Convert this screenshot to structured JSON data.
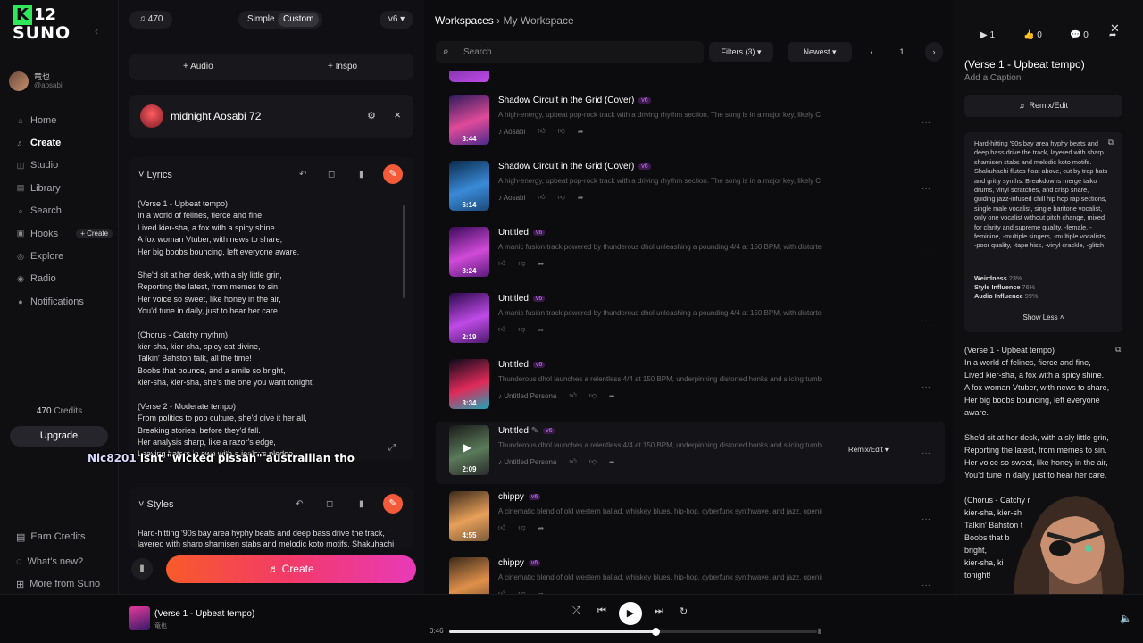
{
  "app": {
    "logo_k": "K",
    "logo_num": "12",
    "logo_word": "SUNO",
    "collapse": "‹"
  },
  "user": {
    "name": "竜也",
    "handle": "@aosabi"
  },
  "nav": {
    "items": [
      {
        "label": "Home",
        "icon": "⌂"
      },
      {
        "label": "Create",
        "icon": "♬"
      },
      {
        "label": "Studio",
        "icon": "◫"
      },
      {
        "label": "Library",
        "icon": "▤"
      },
      {
        "label": "Search",
        "icon": "⌕"
      },
      {
        "label": "Hooks",
        "icon": "▣"
      },
      {
        "label": "Explore",
        "icon": "◎"
      },
      {
        "label": "Radio",
        "icon": "◉"
      },
      {
        "label": "Notifications",
        "icon": "●"
      }
    ],
    "hooks_create": "+ Create",
    "credits_value": "470",
    "credits_label": "Credits",
    "upgrade": "Upgrade",
    "bottom": [
      {
        "label": "Earn Credits",
        "icon": "▤"
      },
      {
        "label": "What's new?",
        "icon": "◌"
      },
      {
        "label": "More from Suno",
        "icon": "⊞"
      }
    ],
    "socials": [
      "♪",
      "◈"
    ]
  },
  "create_panel": {
    "credits_pill": "♫ 470",
    "mode_simple": "Simple",
    "mode_custom": "Custom",
    "version": "v6 ▾",
    "add_audio": "+ Audio",
    "add_inspo": "+ Inspo",
    "song_title": "midnight Aosabi 72",
    "lyrics_label": "Lyrics",
    "lyrics": [
      [
        "(Verse 1 - Upbeat tempo)",
        "In a world of felines, fierce and fine,",
        "Lived kier-sha, a fox with a spicy shine.",
        "A fox woman Vtuber, with news to share,",
        "Her big boobs bouncing, left everyone aware."
      ],
      [
        "She'd sit at her desk, with a sly little grin,",
        "Reporting the latest, from memes to sin.",
        "Her voice so sweet, like honey in the air,",
        "You'd tune in daily, just to hear her care."
      ],
      [
        "(Chorus - Catchy rhythm)",
        "kier-sha, kier-sha, spicy cat divine,",
        "Talkin' Bahston talk, all the time!",
        "Boobs that bounce, and a smile so bright,",
        "kier-sha, kier-sha, she's the one you want tonight!"
      ],
      [
        "(Verse 2 - Moderate tempo)",
        "From politics to pop culture, she'd give it her all,",
        "Breaking stories, before they'd fall.",
        "Her analysis sharp, like a razor's edge,",
        "Leaving haters in awe with a jealous pledge."
      ]
    ],
    "styles_label": "Styles",
    "styles_text": "Hard-hitting '90s bay area hyphy beats and deep bass drive the track, layered with sharp shamisen stabs and melodic koto motifs. Shakuhachi",
    "create_button": "♬ Create"
  },
  "overlay_chat": {
    "name": "Nic8201",
    "message": "isnt \"wicked pissah\" australlian tho"
  },
  "workspace": {
    "breadcrumb_root": "Workspaces",
    "breadcrumb_sep": "›",
    "breadcrumb_current": "My Workspace",
    "search_placeholder": "Search",
    "filters": "Filters (3) ▾",
    "sort": "Newest ▾",
    "page": "1",
    "songs": [
      {
        "title": "Shadow Circuit in the Grid (Cover)",
        "tag": "v6",
        "desc": "A high-energy, upbeat pop-rock track with a driving rhythm section. The song is in a major key, likely C maj...",
        "duration": "3:44",
        "persona": "Aosabi",
        "colors": [
          "#2a1a5a",
          "#e04a9a",
          "#4a2a8a"
        ]
      },
      {
        "title": "Shadow Circuit in the Grid (Cover)",
        "tag": "v6",
        "desc": "A high-energy, upbeat pop-rock track with a driving rhythm section. The song is in a major key, likely C maj...",
        "duration": "6:14",
        "persona": "Aosabi",
        "colors": [
          "#0a2a4a",
          "#3a8ad8",
          "#1a4a7a"
        ]
      },
      {
        "title": "Untitled",
        "tag": "v6",
        "desc": "A manic fusion track powered by thunderous dhol unleashing a pounding 4/4 at 150 BPM, with distorted h...",
        "duration": "3:24",
        "persona": "",
        "colors": [
          "#3a0a5a",
          "#d04ad8",
          "#5a1a7a"
        ]
      },
      {
        "title": "Untitled",
        "tag": "v6",
        "desc": "A manic fusion track powered by thunderous dhol unleashing a pounding 4/4 at 150 BPM, with distorted h...",
        "duration": "2:19",
        "persona": "",
        "colors": [
          "#2a0a4a",
          "#c04ae8",
          "#4a1a6a"
        ]
      },
      {
        "title": "Untitled",
        "tag": "v6",
        "desc": "Thunderous dhol launches a relentless 4/4 at 150 BPM, underpinning distorted honks and slicing tumbi riff...",
        "duration": "3:34",
        "persona": "Untitled Persona",
        "colors": [
          "#0a0a1a",
          "#e02a5a",
          "#1aa8b8"
        ]
      },
      {
        "title": "Untitled",
        "tag": "v6",
        "desc": "Thunderous dhol launches a relentless 4/4 at 150 BPM, underpinning distorted honks and slicing tumbi riff...",
        "duration": "2:09",
        "persona": "Untitled Persona",
        "colors": [
          "#1a1a1a",
          "#5a7a5a",
          "#2a2a2a"
        ]
      },
      {
        "title": "chippy",
        "tag": "v6",
        "desc": "A cinematic blend of old western ballad, whiskey blues, hip-hop, cyberfunk synthwave, and jazz, opening...",
        "duration": "4:55",
        "persona": "",
        "colors": [
          "#3a2a1a",
          "#e8a05a",
          "#7a5a3a"
        ]
      },
      {
        "title": "chippy",
        "tag": "v6",
        "desc": "A cinematic blend of old western ballad, whiskey blues, hip-hop, cyberfunk synthwave, and jazz, opening...",
        "duration": "",
        "persona": "",
        "colors": [
          "#3a2a1a",
          "#e0904a",
          "#6a4a2a"
        ]
      }
    ],
    "remix_edit": "Remix/Edit ▾",
    "more": "···"
  },
  "details": {
    "plays": "▶ 1",
    "likes": "👍 0",
    "comments": "💬 0",
    "title": "(Verse 1 - Upbeat tempo)",
    "caption": "Add a Caption",
    "remix": "♬ Remix/Edit",
    "prompt": "Hard-hitting '90s bay area hyphy beats and deep bass drive the track, layered with sharp shamisen stabs and melodic koto motifs. Shakuhachi flutes float above, cut by trap hats and gritty synths. Breakdowns merge taiko drums, vinyl scratches, and crisp snare, guiding jazz-infused chill hip hop rap sections, single male vocalist, single baritone vocalist, only one vocalist without pitch change, mixed for clarity and supreme quality, -female, -feminine, -multiple singers, -multiple vocalists, -poor quality, -tape hiss, -vinyl crackle, -glitch",
    "weirdness_label": "Weirdness",
    "weirdness": "23%",
    "style_label": "Style Influence",
    "style": "76%",
    "audio_label": "Audio Influence",
    "audio": "99%",
    "show_less": "Show Less ˄",
    "lyrics": [
      [
        "(Verse 1 - Upbeat tempo)",
        "In a world of felines, fierce and fine,",
        "Lived kier-sha, a fox with a spicy shine.",
        "A fox woman Vtuber, with news to share,",
        "Her big boobs bouncing, left everyone aware."
      ],
      [
        "She'd sit at her desk, with a sly little grin,",
        "Reporting the latest, from memes to sin.",
        "Her voice so sweet, like honey in the air,",
        "You'd tune in daily, just to hear her care."
      ],
      [
        "(Chorus - Catchy r",
        "kier-sha, kier-sh",
        "Talkin' Bahston t",
        "Boobs that b",
        "bright,",
        "kier-sha, ki",
        "tonight!"
      ]
    ]
  },
  "player": {
    "title": "(Verse 1 - Upbeat tempo)",
    "artist": "竜也",
    "time": "0:46",
    "progress": 0.56
  },
  "colors": {
    "accent": "#f25a3a",
    "tag": "#d078ff"
  }
}
